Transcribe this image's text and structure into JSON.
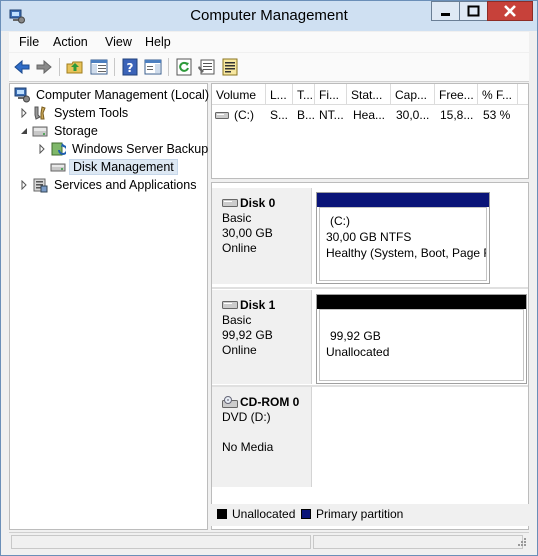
{
  "window": {
    "title": "Computer Management"
  },
  "menu": [
    "File",
    "Action",
    "View",
    "Help"
  ],
  "toolbar": {
    "buttons": [
      "back-icon",
      "forward-icon",
      "up-folder-icon",
      "show-hide-tree-icon",
      "help-icon",
      "show-action-pane-icon",
      "refresh-icon",
      "properties-icon",
      "export-icon"
    ]
  },
  "tree": {
    "root": "Computer Management (Local)",
    "system_tools": "System Tools",
    "storage": "Storage",
    "windows_server_backup": "Windows Server Backup",
    "disk_management": "Disk Management",
    "services_and_applications": "Services and Applications"
  },
  "volume_list": {
    "columns": [
      "Volume",
      "L...",
      "T...",
      "Fi...",
      "Stat...",
      "Cap...",
      "Free...",
      "% F..."
    ],
    "rows": [
      [
        "(C:)",
        "S...",
        "B...",
        "NT...",
        "Hea...",
        "30,0...",
        "15,8...",
        "53 %"
      ]
    ]
  },
  "disks": [
    {
      "name": "Disk 0",
      "type": "Basic",
      "size": "30,00 GB",
      "status": "Online",
      "volume": {
        "label": "(C:)",
        "detail": "30,00 GB NTFS",
        "status": "Healthy (System, Boot, Page F",
        "bar_color": "#0a1478"
      }
    },
    {
      "name": "Disk 1",
      "type": "Basic",
      "size": "99,92 GB",
      "status": "Online",
      "volume": {
        "label": "",
        "detail": "99,92 GB",
        "status": "Unallocated",
        "bar_color": "#000000"
      }
    },
    {
      "name": "CD-ROM 0",
      "type": "DVD (D:)",
      "size": "",
      "status": "No Media"
    }
  ],
  "legend": [
    {
      "label": "Unallocated",
      "color": "#000000"
    },
    {
      "label": "Primary partition",
      "color": "#0a1478"
    }
  ]
}
